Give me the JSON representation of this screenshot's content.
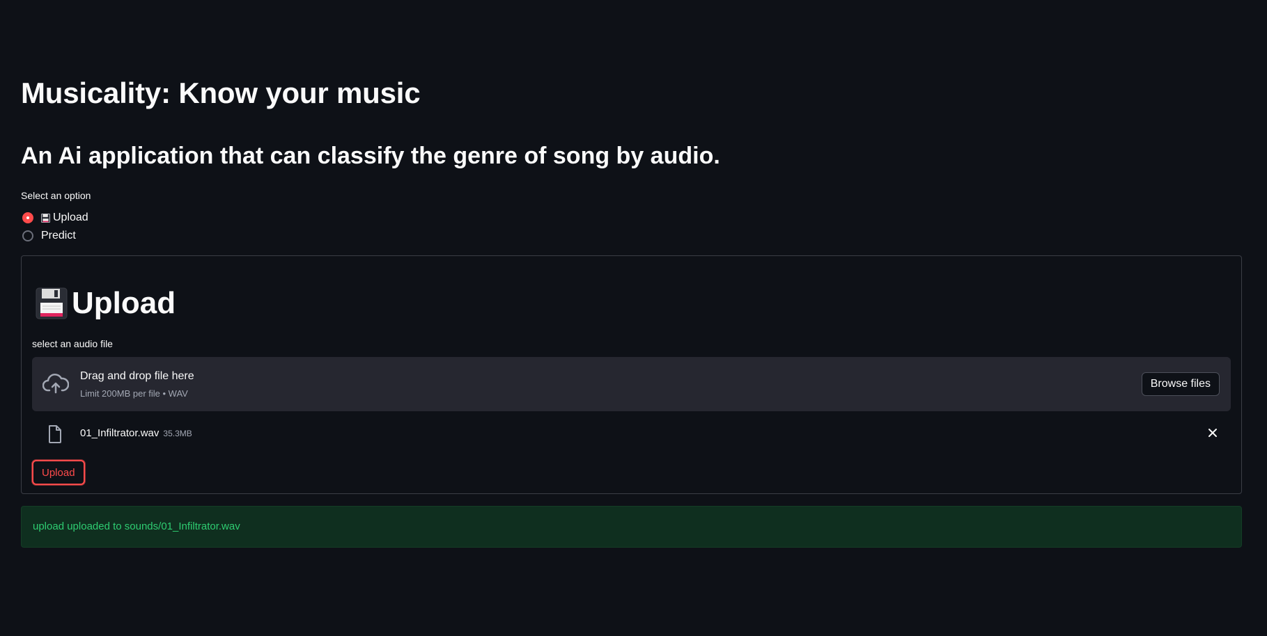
{
  "header": {
    "title": "Musicality: Know your music",
    "subtitle": "An Ai application that can classify the genre of song by audio."
  },
  "radio": {
    "label": "Select an option",
    "options": [
      {
        "label": "Upload",
        "icon": "floppy-disk-icon",
        "selected": true
      },
      {
        "label": "Predict",
        "icon": "",
        "selected": false
      }
    ]
  },
  "form": {
    "heading": "Upload",
    "heading_icon": "floppy-disk-icon",
    "file_label": "select an audio file",
    "dropzone": {
      "title": "Drag and drop file here",
      "subtitle": "Limit 200MB per file • WAV",
      "browse_label": "Browse files"
    },
    "uploaded_file": {
      "name": "01_Infiltrator.wav",
      "size": "35.3MB"
    },
    "submit_label": "Upload"
  },
  "status": {
    "message": "upload uploaded to sounds/01_Infiltrator.wav"
  },
  "colors": {
    "background": "#0e1117",
    "accent": "#ff4b4b",
    "success_text": "#2ecc71",
    "success_bg": "#0f2f1f"
  }
}
